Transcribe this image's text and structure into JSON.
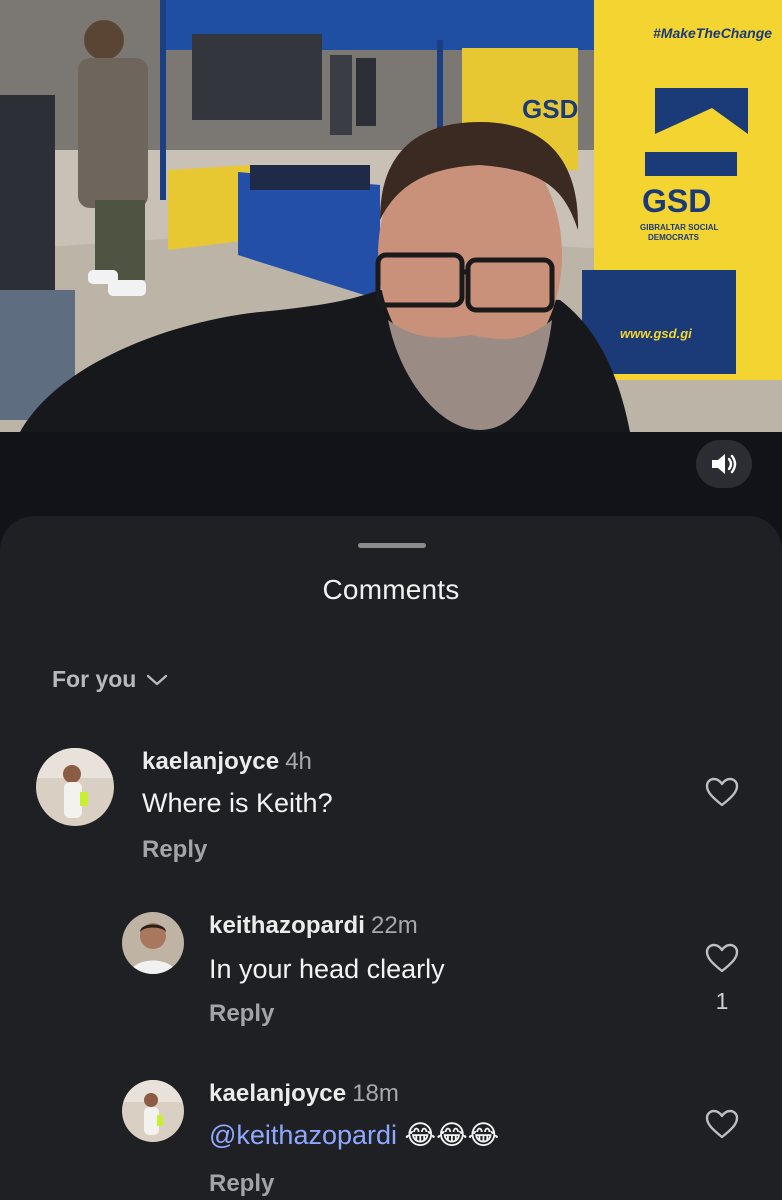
{
  "video": {
    "banner_hashtag": "#MakeTheChange",
    "banner_logo": "GSD",
    "banner_subtitle_line1": "GIBRALTAR SOCIAL",
    "banner_subtitle_line2": "DEMOCRATS",
    "banner_url": "www.gsd.gi",
    "small_banner_logo": "GSD",
    "colors": {
      "gsd_yellow": "#f3d431",
      "gsd_navy": "#1b3b78",
      "tent_blue": "#1f4fa3"
    }
  },
  "sound_button": {
    "icon": "speaker-icon"
  },
  "comments_sheet": {
    "title": "Comments",
    "filter_label": "For you",
    "comments": [
      {
        "username": "kaelanjoyce",
        "time": "4h",
        "text": "Where is Keith?",
        "reply_label": "Reply",
        "like_count": ""
      },
      {
        "username": "keithazopardi",
        "time": "22m",
        "text": "In your head clearly",
        "reply_label": "Reply",
        "like_count": "1"
      },
      {
        "username": "kaelanjoyce",
        "time": "18m",
        "mention": "@keithazopardi",
        "emojis": "😂😂😂",
        "reply_label": "Reply",
        "like_count": ""
      }
    ]
  }
}
